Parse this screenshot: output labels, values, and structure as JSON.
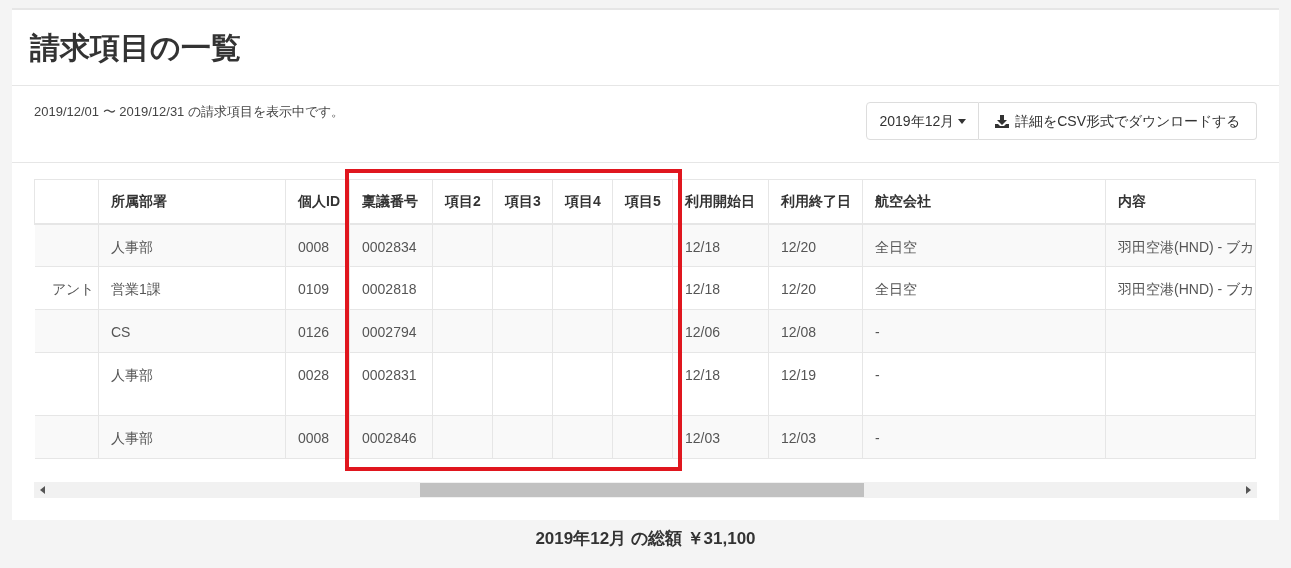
{
  "page_title": "請求項目の一覧",
  "period_text": "2019/12/01 〜 2019/12/31 の請求項目を表示中です。",
  "month_dropdown": {
    "value": "2019年12月"
  },
  "download_button": {
    "label": "詳細をCSV形式でダウンロードする"
  },
  "table": {
    "columns": [
      "",
      "所属部署",
      "個人ID",
      "稟議番号",
      "項目2",
      "項目3",
      "項目4",
      "項目5",
      "利用開始日",
      "利用終了日",
      "航空会社",
      "内容"
    ],
    "rows": [
      {
        "cells": [
          null,
          "人事部",
          "0008",
          "0002834",
          null,
          null,
          null,
          null,
          "12/18",
          "12/20",
          "全日空",
          "羽田空港(HND) - ブカ"
        ]
      },
      {
        "cells": [
          "アント",
          "営業1課",
          "0109",
          "0002818",
          null,
          null,
          null,
          null,
          "12/18",
          "12/20",
          "全日空",
          "羽田空港(HND) - ブカ"
        ]
      },
      {
        "cells": [
          null,
          "CS",
          "0126",
          "0002794",
          null,
          null,
          null,
          null,
          "12/06",
          "12/08",
          "-",
          null
        ]
      },
      {
        "cells": [
          null,
          "人事部",
          "0028",
          "0002831",
          null,
          null,
          null,
          null,
          "12/18",
          "12/19",
          "-",
          null
        ],
        "tall": true
      },
      {
        "cells": [
          null,
          "人事部",
          "0008",
          "0002846",
          null,
          null,
          null,
          null,
          "12/03",
          "12/03",
          "-",
          null
        ]
      }
    ]
  },
  "total_text": "2019年12月 の総額 ￥31,100"
}
